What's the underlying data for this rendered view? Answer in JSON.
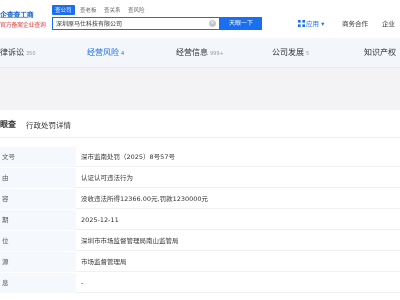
{
  "logo": {
    "line1": "企查查工商",
    "line2": "官方备案企业查询"
  },
  "search": {
    "tabs": [
      "查公司",
      "查老板",
      "查关系",
      "查风险"
    ],
    "value": "深圳原马仕科技有限公司",
    "clear_icon": "clear-icon",
    "button_label": "天眼一下"
  },
  "header_nav": {
    "app_label": "应用",
    "biz_label": "商务合作",
    "ent_label": "企业"
  },
  "category_tabs": [
    {
      "label": "律诉讼",
      "count": "350",
      "active": false
    },
    {
      "label": "经营风险",
      "count": "4",
      "active": true
    },
    {
      "label": "经营信息",
      "count": "999+",
      "active": false
    },
    {
      "label": "公司发展",
      "count": "5",
      "active": false
    },
    {
      "label": "知识产权",
      "count": "",
      "active": false
    }
  ],
  "panel": {
    "brand": "眼查",
    "title": "行政处罚详情",
    "rows": [
      {
        "label": "文号",
        "value": "深市监南处罚（2025）8号57号"
      },
      {
        "label": "由",
        "value": "认证认可违法行为"
      },
      {
        "label": "容",
        "value": "没收违法所得12366.00元,罚款1230000元"
      },
      {
        "label": "期",
        "value": "2025-12-11"
      },
      {
        "label": "位",
        "value": "深圳市市场监督管理局南山监管局"
      },
      {
        "label": "源",
        "value": "市场监督管理局"
      },
      {
        "label": "息",
        "value": "-"
      }
    ]
  },
  "colors": {
    "accent": "#1a6ff0",
    "logo_red": "#e23a3a"
  }
}
